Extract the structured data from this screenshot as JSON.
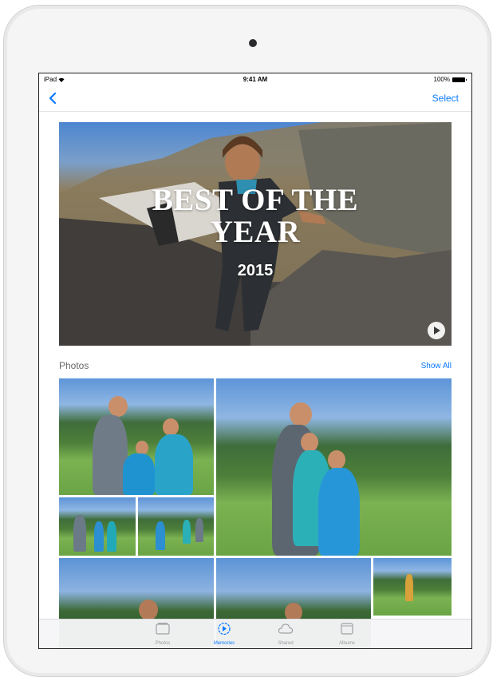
{
  "status_bar": {
    "device": "iPad",
    "time": "9:41 AM",
    "battery": "100%"
  },
  "nav": {
    "select_label": "Select"
  },
  "memory": {
    "title_line1": "BEST OF THE",
    "title_line2": "YEAR",
    "year": "2015"
  },
  "photos_section": {
    "title": "Photos",
    "show_all_label": "Show All"
  },
  "tabs": [
    {
      "label": "Photos",
      "icon": "photos-icon"
    },
    {
      "label": "Memories",
      "icon": "memories-icon",
      "active": true
    },
    {
      "label": "Shared",
      "icon": "cloud-icon"
    },
    {
      "label": "Albums",
      "icon": "albums-icon"
    }
  ],
  "colors": {
    "accent": "#0a7aff"
  }
}
